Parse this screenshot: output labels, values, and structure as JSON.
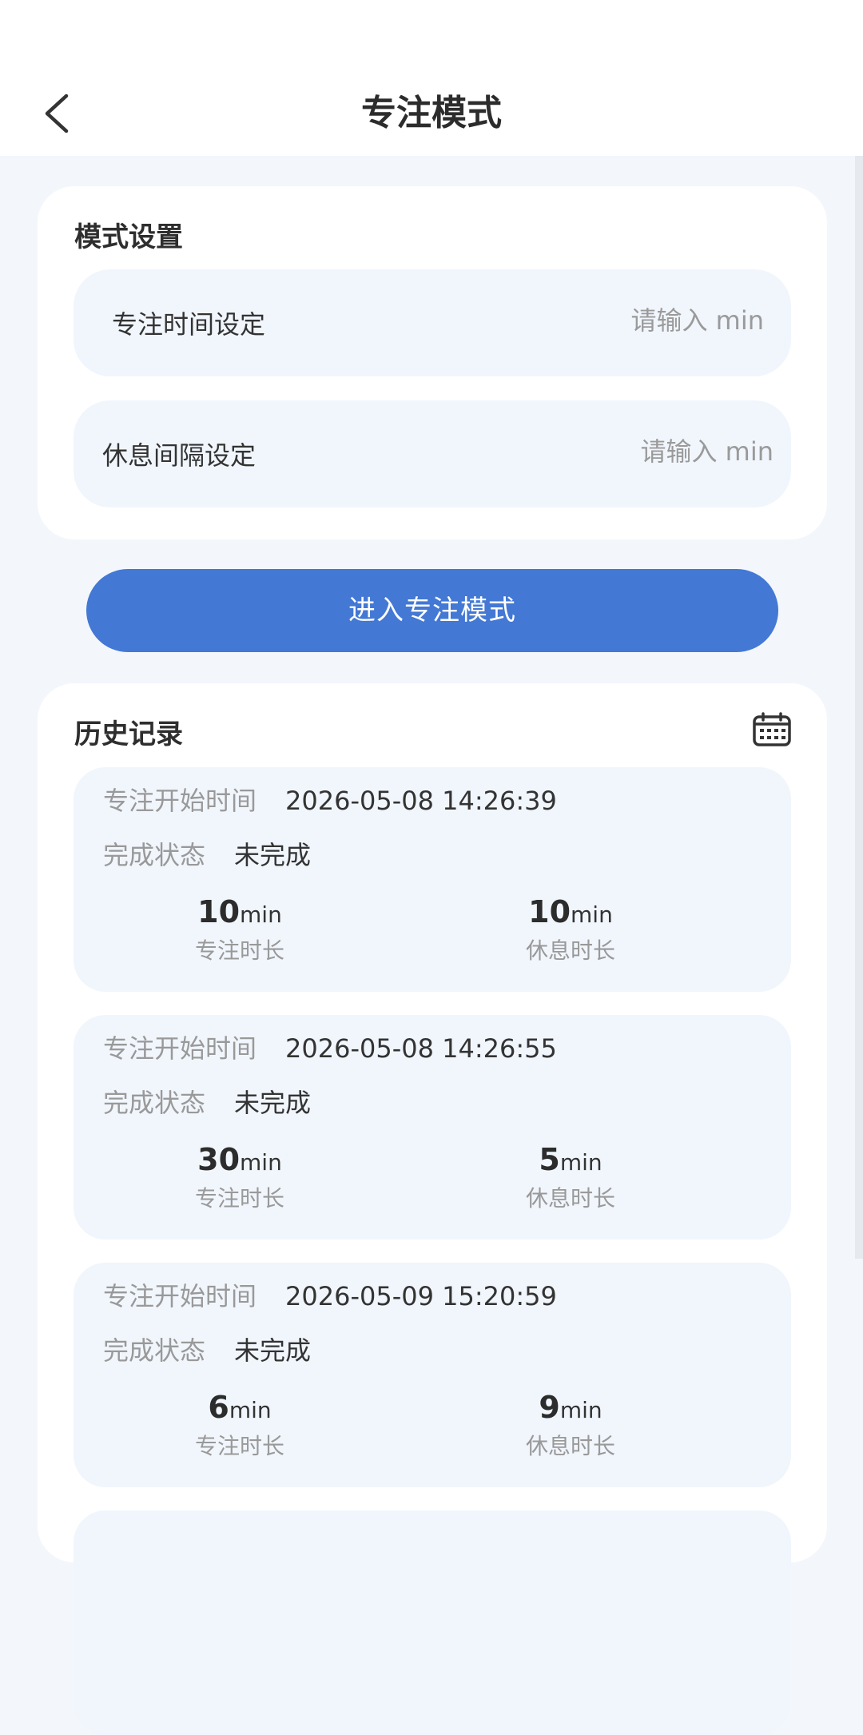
{
  "header": {
    "title": "专注模式"
  },
  "settings": {
    "section_title": "模式设置",
    "focus_time": {
      "label": "专注时间设定",
      "placeholder": "请输入 min"
    },
    "rest_interval": {
      "label": "休息间隔设定",
      "placeholder": "请输入 min"
    }
  },
  "enter_button": {
    "label": "进入专注模式"
  },
  "history": {
    "section_title": "历史记录",
    "start_time_label": "专注开始时间",
    "status_label": "完成状态",
    "focus_duration_label": "专注时长",
    "rest_duration_label": "休息时长",
    "unit": "min",
    "records": [
      {
        "start_time": "2026-05-08 14:26:39",
        "status": "未完成",
        "focus": "10",
        "rest": "10"
      },
      {
        "start_time": "2026-05-08 14:26:55",
        "status": "未完成",
        "focus": "30",
        "rest": "5"
      },
      {
        "start_time": "2026-05-09 15:20:59",
        "status": "未完成",
        "focus": "6",
        "rest": "9"
      }
    ]
  },
  "colors": {
    "accent": "#4378d4",
    "page_bg": "#f3f7fc",
    "field_bg": "#f1f6fd"
  },
  "icons": {
    "back": "chevron-left-icon",
    "calendar": "calendar-icon"
  }
}
